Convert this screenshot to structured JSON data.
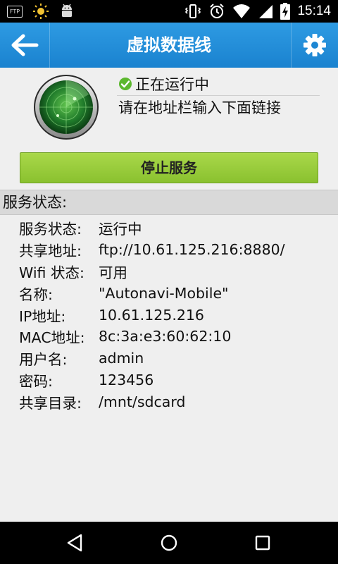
{
  "status_bar": {
    "time": "15:14",
    "ftp_icon_text": "FTP",
    "left_icons": [
      "ftp-notification-icon",
      "sun-icon",
      "android-icon"
    ],
    "right_icons": [
      "vibrate-icon",
      "alarm-icon",
      "wifi-icon",
      "cell-signal-icon",
      "battery-charging-icon"
    ]
  },
  "header": {
    "title": "虚拟数据线",
    "back_icon": "arrow-left-icon",
    "settings_icon": "gear-icon"
  },
  "service": {
    "running_text": "正在运行中",
    "hint": "请在地址栏输入下面链接",
    "stop_button_label": "停止服务"
  },
  "section": {
    "title": "服务状态:"
  },
  "info_rows": [
    {
      "label": "服务状态:",
      "value": "运行中"
    },
    {
      "label": "共享地址:",
      "value": "ftp://10.61.125.216:8880/"
    },
    {
      "label": "Wifi 状态:",
      "value": "可用"
    },
    {
      "label": "名称:",
      "value": "\"Autonavi-Mobile\""
    },
    {
      "label": "IP地址:",
      "value": "10.61.125.216"
    },
    {
      "label": "MAC地址:",
      "value": "8c:3a:e3:60:62:10"
    },
    {
      "label": "用户名:",
      "value": "admin"
    },
    {
      "label": "密码:",
      "value": "123456"
    },
    {
      "label": "共享目录:",
      "value": "/mnt/sdcard"
    }
  ],
  "colors": {
    "action_bar": "#1a82cf",
    "button_green": "#8ac12f",
    "status_check": "#5cb82e"
  }
}
